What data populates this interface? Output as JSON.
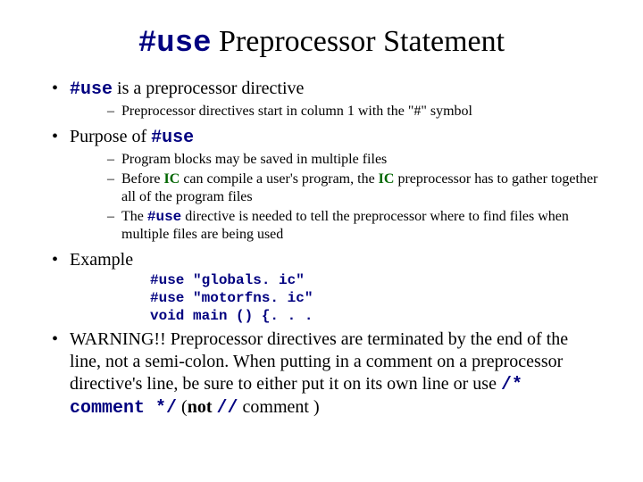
{
  "title_code": "#use",
  "title_rest": " Preprocessor Statement",
  "b1_code": "#use",
  "b1_rest": " is a preprocessor directive",
  "b1_sub1_a": "Preprocessor directives start in column 1 with the ",
  "b1_sub1_b": "\"#\"",
  "b1_sub1_c": " symbol",
  "b2_a": "Purpose of ",
  "b2_code": "#use",
  "b2_sub1": "Program blocks may be saved in multiple files",
  "b2_sub2_a": "Before ",
  "b2_sub2_b": "IC",
  "b2_sub2_c": " can compile a user's program, the ",
  "b2_sub2_d": "IC",
  "b2_sub2_e": " preprocessor has to gather together all of the program files",
  "b2_sub3_a": "The ",
  "b2_sub3_code": "#use",
  "b2_sub3_b": " directive is needed to tell the preprocessor where to find files when multiple files are being used",
  "b3": "Example",
  "code1": "#use \"globals. ic\"",
  "code2": "#use \"motorfns. ic\"",
  "code3": "void main () {. . .",
  "b4_a": "WARNING!! Preprocessor directives are terminated by the end of the line, not a semi-colon.  When putting in a comment on a preprocessor directive's line, be sure to either put it on its own line or use ",
  "b4_code1": "/* comment */",
  "b4_b": " (",
  "b4_not": "not",
  "b4_sp": " ",
  "b4_code2": "//",
  "b4_c": "  comment )"
}
